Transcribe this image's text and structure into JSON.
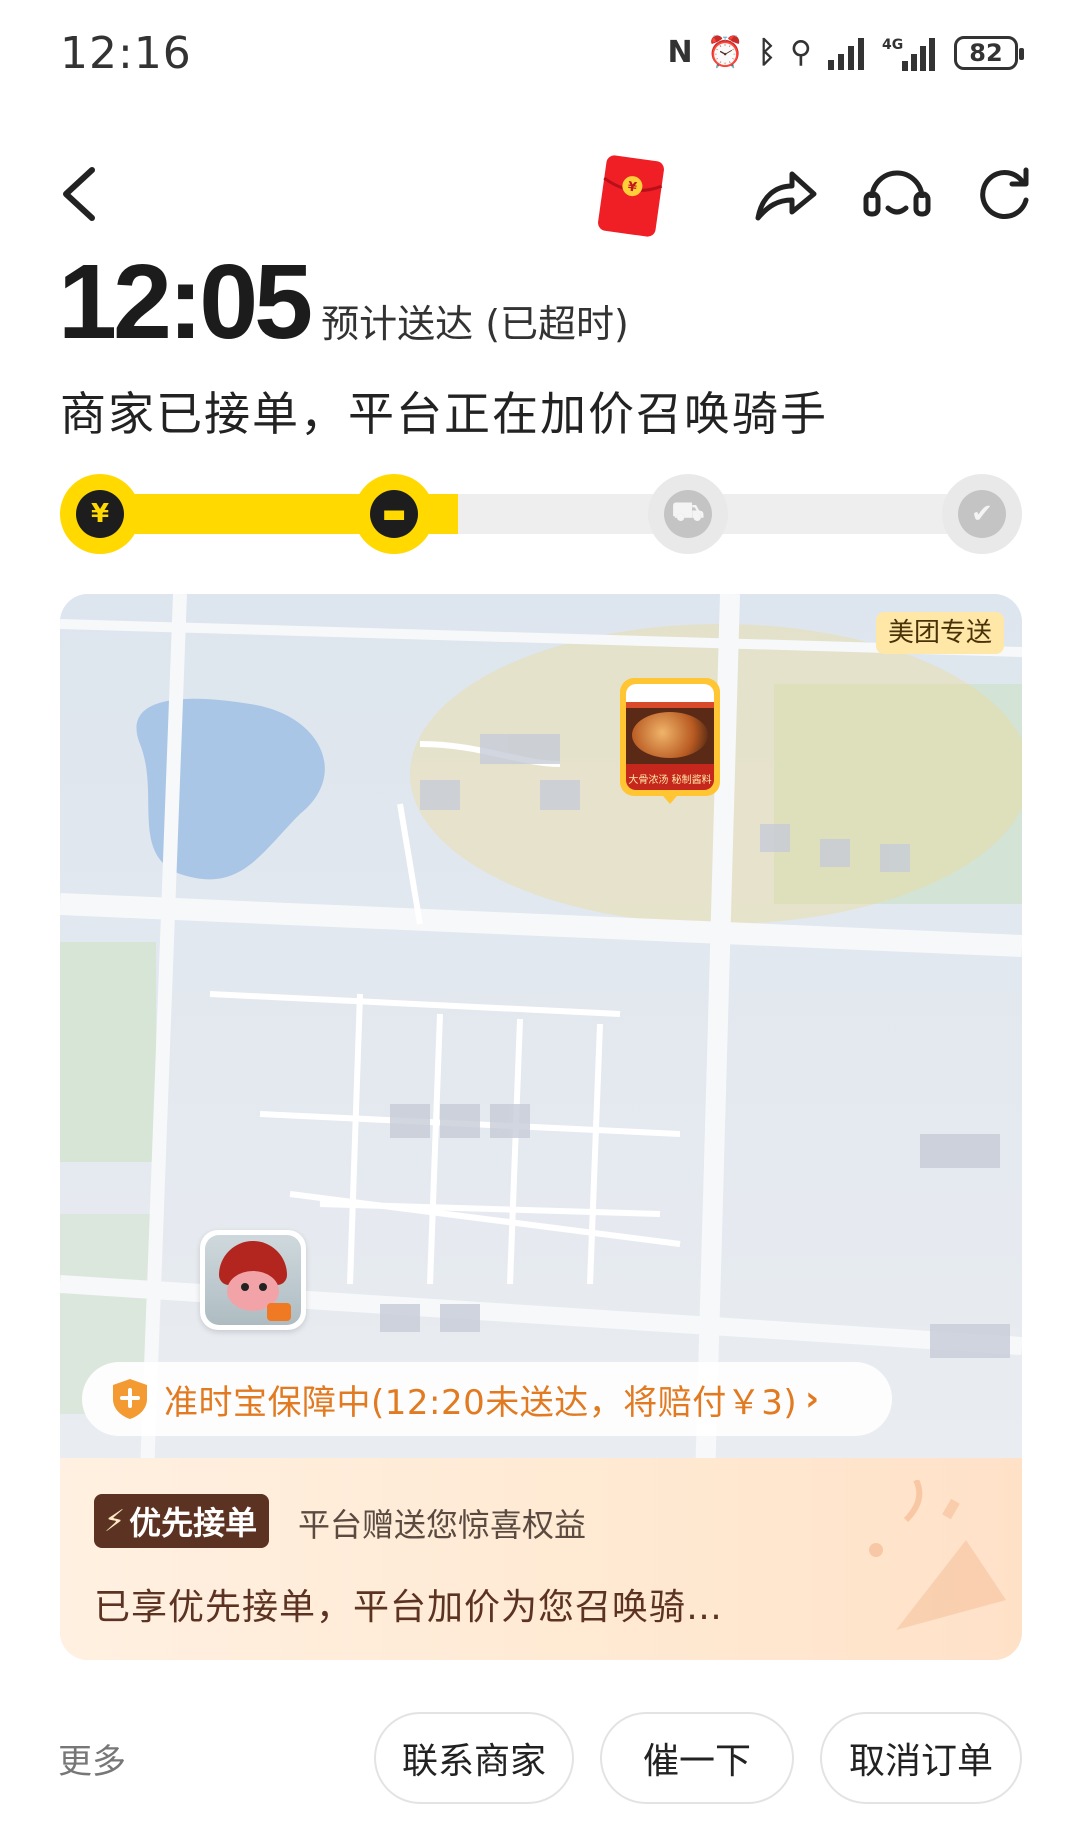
{
  "status_bar": {
    "time": "12:16",
    "icons": [
      "nfc-icon",
      "alarm-icon",
      "bluetooth-icon",
      "location-icon",
      "signal-icon",
      "4g-signal-icon"
    ],
    "battery": "82"
  },
  "nav": {
    "back_icon": "chevron-left-icon",
    "red_packet_icon": "red-envelope-icon",
    "share_icon": "share-icon",
    "service_icon": "headset-icon",
    "refresh_icon": "refresh-icon"
  },
  "order": {
    "eta_time": "12:05",
    "eta_label": "预计送达 (已超时)",
    "status_title": "商家已接单，平台正在加价召唤骑手"
  },
  "progress": {
    "fraction": 0.4,
    "steps": [
      {
        "name": "payment",
        "icon": "yen-icon",
        "glyph": "¥",
        "active": true
      },
      {
        "name": "merchant",
        "icon": "store-icon",
        "glyph": "▬",
        "active": true
      },
      {
        "name": "rider",
        "icon": "scooter-icon",
        "glyph": "⛟",
        "active": false
      },
      {
        "name": "delivered",
        "icon": "check-icon",
        "glyph": "✔",
        "active": false
      }
    ]
  },
  "map": {
    "service_tag": "美团专送",
    "shop_banner": "大骨浓汤 秘制酱料"
  },
  "guarantee": {
    "text": "准时宝保障中(12:20未送达，将赔付￥3)",
    "chevron": "›",
    "accent": "#e17a20"
  },
  "priority": {
    "badge": "优先接单",
    "subtitle": "平台赠送您惊喜权益",
    "description": "已享优先接单，平台加价为您召唤骑…"
  },
  "actions": {
    "more": "更多",
    "contact_merchant": "联系商家",
    "urge": "催一下",
    "cancel_order": "取消订单"
  },
  "colors": {
    "brand_yellow": "#ffd900",
    "priority_brown": "#5c3222"
  }
}
